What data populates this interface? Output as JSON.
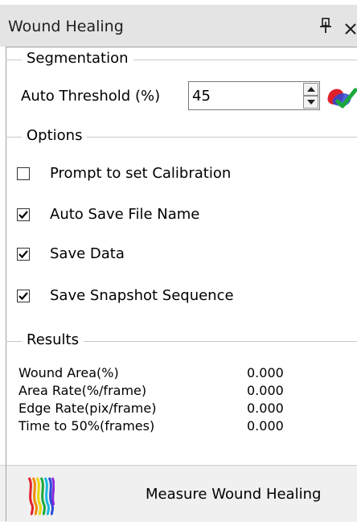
{
  "panel": {
    "title": "Wound Healing"
  },
  "segmentation": {
    "title": "Segmentation",
    "threshold_label": "Auto Threshold (%)",
    "threshold_value": "45"
  },
  "options": {
    "title": "Options",
    "items": [
      {
        "label": "Prompt to set Calibration",
        "checked": false
      },
      {
        "label": "Auto Save File Name",
        "checked": true
      },
      {
        "label": "Save Data",
        "checked": true
      },
      {
        "label": "Save Snapshot Sequence",
        "checked": true
      }
    ]
  },
  "results": {
    "title": "Results",
    "rows": [
      {
        "label": "Wound Area(%)",
        "value": "0.000"
      },
      {
        "label": "Area Rate(%/frame)",
        "value": "0.000"
      },
      {
        "label": "Edge Rate(pix/frame)",
        "value": "0.000"
      },
      {
        "label": "Time to 50%(frames)",
        "value": "0.000"
      }
    ]
  },
  "action": {
    "label": "Measure Wound Healing"
  },
  "icons": {
    "pin": "pin-icon",
    "close": "close-icon",
    "spin_up": "spin-up-icon",
    "spin_down": "spin-down-icon",
    "threshold_pick": "color-pick-icon",
    "measure": "wound-healing-icon",
    "check": "checkmark-icon"
  },
  "colors": {
    "titlebar_bg": "#e4e4e4",
    "accent_red": "#e0202a",
    "accent_green": "#1aa83a",
    "accent_blue": "#2a4ad8"
  }
}
